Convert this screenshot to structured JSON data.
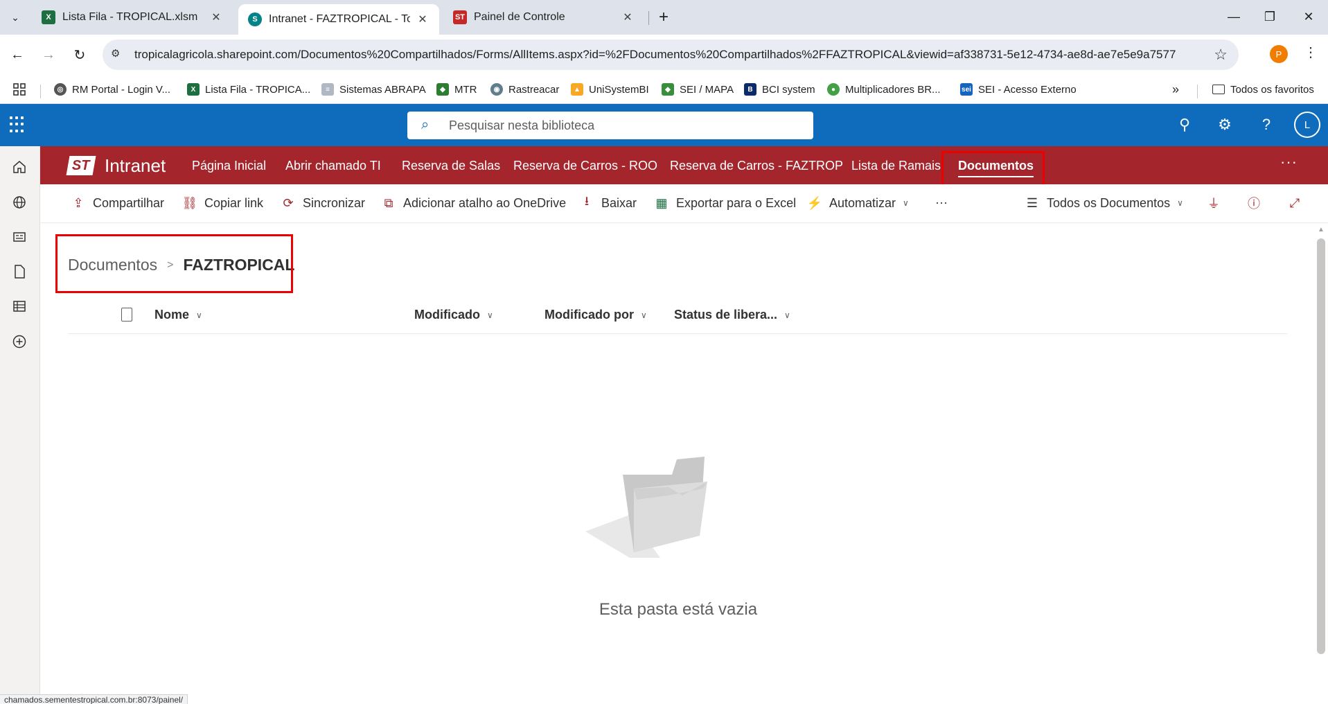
{
  "browser": {
    "tabs": [
      {
        "title": "Lista Fila - TROPICAL.xlsm",
        "favicon": "excel-icon"
      },
      {
        "title": "Intranet - FAZTROPICAL - Todos",
        "favicon": "sharepoint-icon"
      },
      {
        "title": "Painel de Controle",
        "favicon": "st-icon"
      }
    ],
    "url": "tropicalagricola.sharepoint.com/Documentos%20Compartilhados/Forms/AllItems.aspx?id=%2FDocumentos%20Compartilhados%2FFAZTROPICAL&viewid=af338731-5e12-4734-ae8d-ae7e5e9a7577",
    "profile_initial": "P",
    "bookmarks": [
      "RM Portal - Login V...",
      "Lista Fila - TROPICA...",
      "Sistemas ABRAPA",
      "MTR",
      "Rastreacar",
      "UniSystemBI",
      "SEI / MAPA",
      "BCI system",
      "Multiplicadores BR...",
      "SEI - Acesso Externo"
    ],
    "all_bookmarks_label": "Todos os favoritos",
    "status_url": "chamados.sementestropical.com.br:8073/painel/"
  },
  "suite": {
    "search_placeholder": "Pesquisar nesta biblioteca",
    "avatar_initial": "L",
    "accent_color": "#0f6cbd"
  },
  "site": {
    "logo_text": "ST",
    "title": "Intranet",
    "nav": [
      "Página Inicial",
      "Abrir chamado TI",
      "Reserva de Salas",
      "Reserva de Carros - ROO",
      "Reserva de Carros - FAZTROP",
      "Lista de Ramais",
      "Documentos"
    ],
    "selected_nav": "Documentos",
    "brand_color": "#a4262c"
  },
  "commands": {
    "share": "Compartilhar",
    "copy_link": "Copiar link",
    "sync": "Sincronizar",
    "add_shortcut": "Adicionar atalho ao OneDrive",
    "download": "Baixar",
    "export_excel": "Exportar para o Excel",
    "automate": "Automatizar",
    "more": "···",
    "view": "Todos os Documentos"
  },
  "breadcrumb": {
    "root": "Documentos",
    "current": "FAZTROPICAL"
  },
  "columns": [
    "Nome",
    "Modificado",
    "Modificado por",
    "Status de libera..."
  ],
  "empty_message": "Esta pasta está vazia"
}
